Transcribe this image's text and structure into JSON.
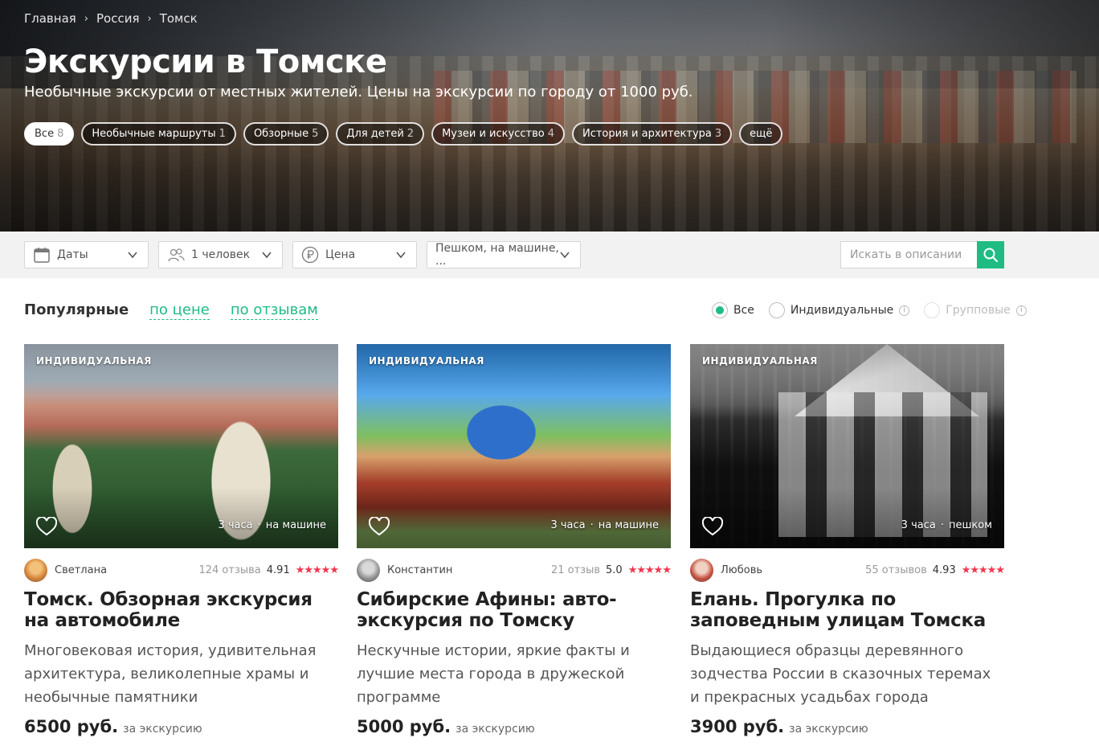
{
  "breadcrumb": [
    "Главная",
    "Россия",
    "Томск"
  ],
  "hero": {
    "title": "Экскурсии в Томске",
    "subtitle": "Необычные экскурсии от местных жителей. Цены на экскурсии по городу от 1000 руб."
  },
  "chips": [
    {
      "label": "Все",
      "count": "8"
    },
    {
      "label": "Необычные маршруты",
      "count": "1"
    },
    {
      "label": "Обзорные",
      "count": "5"
    },
    {
      "label": "Для детей",
      "count": "2"
    },
    {
      "label": "Музеи и искусство",
      "count": "4"
    },
    {
      "label": "История и архитектура",
      "count": "3"
    },
    {
      "label": "ещё",
      "count": ""
    }
  ],
  "filters": {
    "dates": "Даты",
    "people": "1 человек",
    "price": "Цена",
    "transport": "Пешком, на машине, ...",
    "search_placeholder": "Искать в описании"
  },
  "sort": {
    "active": "Популярные",
    "by_price": "по цене",
    "by_reviews": "по отзывам"
  },
  "type_filter": {
    "all": "Все",
    "individual": "Индивидуальные",
    "group": "Групповые"
  },
  "cards": [
    {
      "badge": "ИНДИВИДУАЛЬНАЯ",
      "duration": "3 часа",
      "transport": "на машине",
      "guide": "Светлана",
      "reviews": "124 отзыва",
      "score": "4.91",
      "stars": "★★★★★",
      "title": "Томск. Обзорная экскурсия на автомобиле",
      "description": "Многовековая история, удивительная архитектура, великолепные храмы и необычные памятники",
      "price": "6500 руб.",
      "price_unit": "за экскурсию"
    },
    {
      "badge": "ИНДИВИДУАЛЬНАЯ",
      "duration": "3 часа",
      "transport": "на машине",
      "guide": "Константин",
      "reviews": "21 отзыв",
      "score": "5.0",
      "stars": "★★★★★",
      "title": "Сибирские Афины: авто-экскурсия по Томску",
      "description": "Нескучные истории, яркие факты и лучшие места города в дружеской программе",
      "price": "5000 руб.",
      "price_unit": "за экскурсию"
    },
    {
      "badge": "ИНДИВИДУАЛЬНАЯ",
      "duration": "3 часа",
      "transport": "пешком",
      "guide": "Любовь",
      "reviews": "55 отзывов",
      "score": "4.93",
      "stars": "★★★★★",
      "title": "Елань. Прогулка по заповедным улицам Томска",
      "description": "Выдающиеся образцы деревянного зодчества России в сказочных теремах и прекрасных усадьбах города",
      "price": "3900 руб.",
      "price_unit": "за экскурсию"
    }
  ],
  "colors": {
    "accent": "#1ebc83",
    "stars": "#f0364d"
  }
}
